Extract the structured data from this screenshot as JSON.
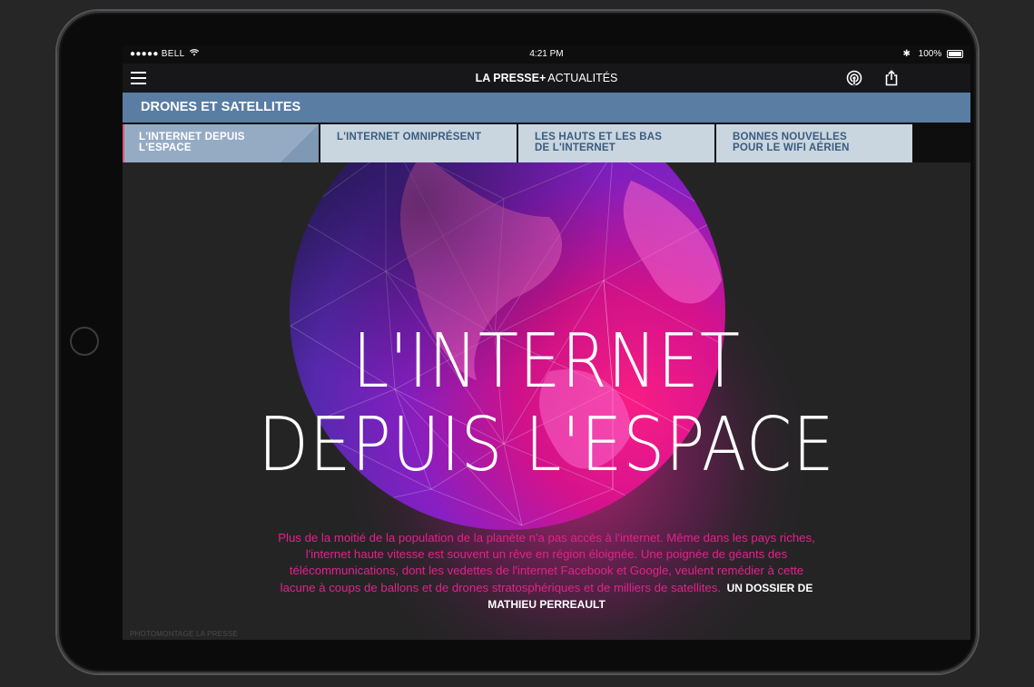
{
  "statusbar": {
    "carrier": "●●●●● BELL",
    "time": "4:21 PM",
    "battery": "100%"
  },
  "navbar": {
    "brand_name": "LA PRESSE",
    "brand_plus": "+",
    "section": "ACTUALITÉS",
    "icons": [
      "menu-icon",
      "podcast-icon",
      "share-icon"
    ]
  },
  "section_header": "DRONES ET SATELLITES",
  "tabs": [
    {
      "label": "L'INTERNET DEPUIS L'ESPACE",
      "active": true
    },
    {
      "label": "L'INTERNET OMNIPRÉSENT",
      "active": false
    },
    {
      "label": "LES HAUTS ET LES BAS DE L'INTERNET",
      "active": false
    },
    {
      "label": "BONNES NOUVELLES POUR LE WIFI AÉRIEN",
      "active": false
    }
  ],
  "hero": {
    "title_line1": "L'INTERNET",
    "title_line2": "DEPUIS L'ESPACE",
    "lede": "Plus de la moitié de la population de la planète n'a pas accès à l'internet. Même dans les pays riches, l'internet haute vitesse est souvent un rêve en région éloignée. Une poignée de géants des télécommunications, dont les vedettes de l'internet Facebook et Google, veulent remédier à cette lacune à coups de ballons et de drones stratosphériques et de milliers de satellites.",
    "byline": "UN DOSSIER DE MATHIEU PERREAULT",
    "credit": "PHOTOMONTAGE LA PRESSE"
  },
  "colors": {
    "accent_blue": "#5a7da3",
    "tab_bg": "#c9d6e0",
    "tab_active": "#95abc4",
    "lede_pink": "#e0238a",
    "hero_bg": "#252425"
  }
}
